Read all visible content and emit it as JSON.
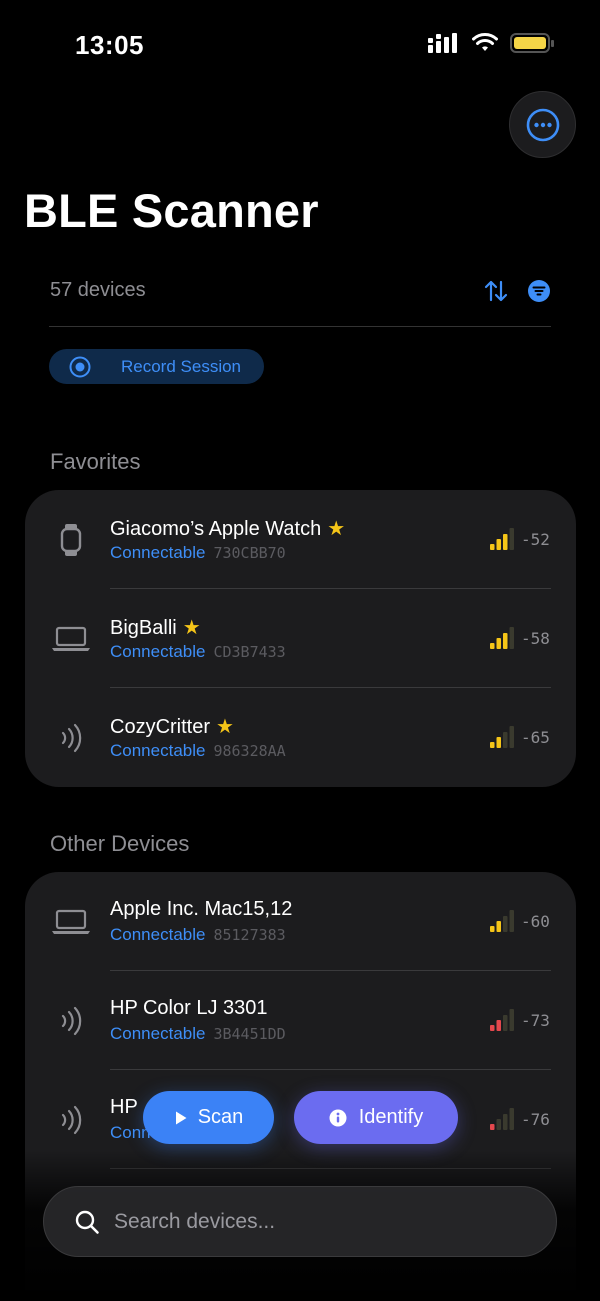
{
  "status_bar": {
    "time": "13:05"
  },
  "header": {
    "title": "BLE Scanner",
    "device_count": "57 devices",
    "record_label": "Record Session"
  },
  "sections": {
    "favorites_title": "Favorites",
    "other_title": "Other Devices"
  },
  "favorites": [
    {
      "name": "Giacomo’s Apple Watch",
      "status": "Connectable",
      "id": "730CBB70",
      "rssi": "-52",
      "icon": "watch-icon",
      "signal_bars": 3,
      "signal_color": "#f5c518"
    },
    {
      "name": "BigBalli",
      "status": "Connectable",
      "id": "CD3B7433",
      "rssi": "-58",
      "icon": "laptop-icon",
      "signal_bars": 3,
      "signal_color": "#f5c518"
    },
    {
      "name": "CozyCritter",
      "status": "Connectable",
      "id": "986328AA",
      "rssi": "-65",
      "icon": "broadcast-icon",
      "signal_bars": 2,
      "signal_color": "#f5c518"
    }
  ],
  "other_devices": [
    {
      "name": "Apple Inc. Mac15,12",
      "status": "Connectable",
      "id": "85127383",
      "rssi": "-60",
      "icon": "laptop-icon",
      "signal_bars": 2,
      "signal_color": "#f5c518"
    },
    {
      "name": "HP Color LJ 3301",
      "status": "Connectable",
      "id": "3B4451DD",
      "rssi": "-73",
      "icon": "broadcast-icon",
      "signal_bars": 2,
      "signal_color": "#e5484d"
    },
    {
      "name": "HP",
      "status": "Conn",
      "id": "",
      "rssi": "-76",
      "icon": "broadcast-icon",
      "signal_bars": 1,
      "signal_color": "#e5484d"
    }
  ],
  "actions": {
    "scan_label": "Scan",
    "identify_label": "Identify"
  },
  "search": {
    "placeholder": "Search devices..."
  },
  "colors": {
    "accent": "#3e8ef7",
    "scan": "#3b82f6",
    "identify": "#6b6cf0",
    "star": "#f5c518"
  }
}
